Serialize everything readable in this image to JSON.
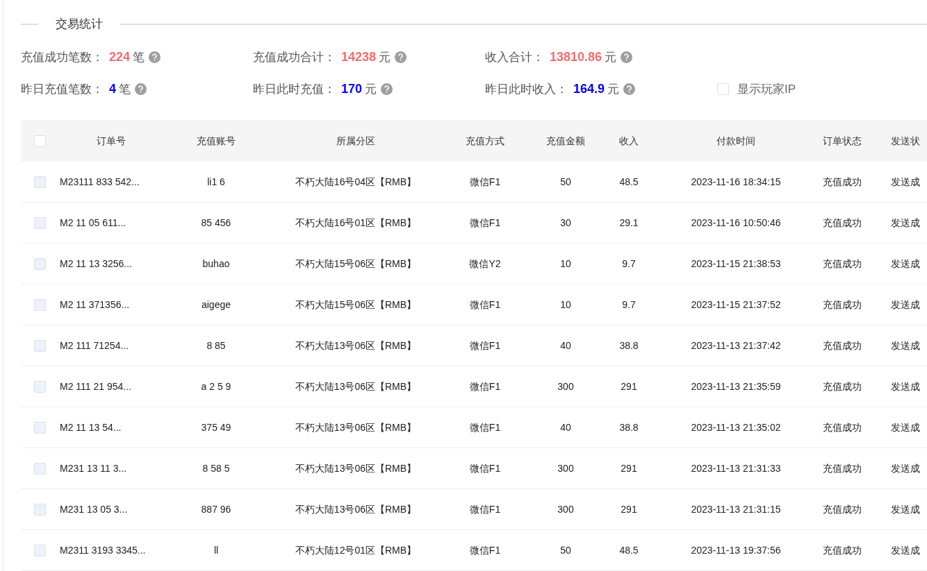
{
  "section_title": "交易统计",
  "stats": [
    {
      "label": "充值成功笔数：",
      "value": "224",
      "unit": "笔",
      "color": "#f56c6c"
    },
    {
      "label": "充值成功合计：",
      "value": "14238",
      "unit": "元",
      "color": "#f56c6c"
    },
    {
      "label": "收入合计：",
      "value": "13810.86",
      "unit": "元",
      "color": "#f56c6c"
    },
    {
      "label": "昨日充值笔数：",
      "value": "4",
      "unit": "笔",
      "color": "#0000ff"
    },
    {
      "label": "昨日此时充值：",
      "value": "170",
      "unit": "元",
      "color": "#0000ff"
    },
    {
      "label": "昨日此时收入：",
      "value": "164.9",
      "unit": "元",
      "color": "#0000ff"
    }
  ],
  "show_ip": {
    "label": "显示玩家IP",
    "checked": false
  },
  "table": {
    "header_checked": false,
    "columns": [
      "订单号",
      "充值账号",
      "所属分区",
      "充值方式",
      "充值金额",
      "收入",
      "付款时间",
      "订单状态",
      "发送状"
    ],
    "rows": [
      {
        "checked": false,
        "cells": [
          "M23111 833 542...",
          "li1 6",
          "不朽大陆16号04区【RMB】",
          "微信F1",
          "50",
          "48.5",
          "2023-11-16 18:34:15",
          "充值成功",
          "发送成"
        ]
      },
      {
        "checked": false,
        "cells": [
          "M2 11 05 611...",
          "85 456",
          "不朽大陆16号01区【RMB】",
          "微信F1",
          "30",
          "29.1",
          "2023-11-16 10:50:46",
          "充值成功",
          "发送成"
        ]
      },
      {
        "checked": false,
        "cells": [
          "M2 11 13 3256...",
          "buhao",
          "不朽大陆15号06区【RMB】",
          "微信Y2",
          "10",
          "9.7",
          "2023-11-15 21:38:53",
          "充值成功",
          "发送成"
        ]
      },
      {
        "checked": false,
        "cells": [
          "M2 11 371356...",
          "aigege",
          "不朽大陆15号06区【RMB】",
          "微信F1",
          "10",
          "9.7",
          "2023-11-15 21:37:52",
          "充值成功",
          "发送成"
        ]
      },
      {
        "checked": false,
        "cells": [
          "M2 111 71254...",
          "8 85",
          "不朽大陆13号06区【RMB】",
          "微信F1",
          "40",
          "38.8",
          "2023-11-13 21:37:42",
          "充值成功",
          "发送成"
        ]
      },
      {
        "checked": false,
        "cells": [
          "M2 111 21 954...",
          "a 2 5 9",
          "不朽大陆13号06区【RMB】",
          "微信F1",
          "300",
          "291",
          "2023-11-13 21:35:59",
          "充值成功",
          "发送成"
        ]
      },
      {
        "checked": false,
        "cells": [
          "M2 11 13 54...",
          "375 49",
          "不朽大陆13号06区【RMB】",
          "微信F1",
          "40",
          "38.8",
          "2023-11-13 21:35:02",
          "充值成功",
          "发送成"
        ]
      },
      {
        "checked": false,
        "cells": [
          "M231 13 11 3...",
          "8 58 5",
          "不朽大陆13号06区【RMB】",
          "微信F1",
          "300",
          "291",
          "2023-11-13 21:31:33",
          "充值成功",
          "发送成"
        ]
      },
      {
        "checked": false,
        "cells": [
          "M231 13 05 3...",
          "887 96",
          "不朽大陆13号06区【RMB】",
          "微信F1",
          "300",
          "291",
          "2023-11-13 21:31:15",
          "充值成功",
          "发送成"
        ]
      },
      {
        "checked": false,
        "cells": [
          "M2311 3193 3345...",
          "ll",
          "不朽大陆12号01区【RMB】",
          "微信F1",
          "50",
          "48.5",
          "2023-11-13 19:37:56",
          "充值成功",
          "发送成"
        ]
      }
    ]
  }
}
